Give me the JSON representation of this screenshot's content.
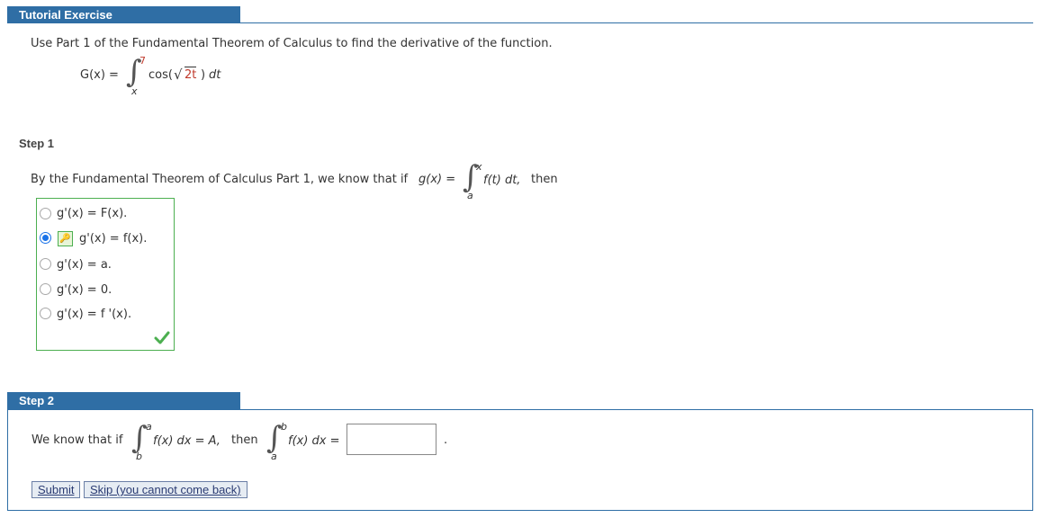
{
  "header": {
    "title": "Tutorial Exercise"
  },
  "problem": {
    "instruction": "Use Part 1 of the Fundamental Theorem of Calculus to find the derivative of the function.",
    "lhs": "G(x) =",
    "upper": "7",
    "lower": "x",
    "cos_open": "cos(",
    "radicand": "2t",
    "close": ")",
    "dt": "dt"
  },
  "step1": {
    "label": "Step 1",
    "text": "By the Fundamental Theorem of Calculus Part 1, we know that if",
    "g_def": "g(x) =",
    "upper": "x",
    "lower": "a",
    "integrand": "f(t) dt,",
    "then": "then",
    "choices": [
      {
        "label": "g'(x) = F(x).",
        "selected": false
      },
      {
        "label": "g'(x) = f(x).",
        "selected": true
      },
      {
        "label": "g'(x) = a.",
        "selected": false
      },
      {
        "label": "g'(x) = 0.",
        "selected": false
      },
      {
        "label": "g'(x) = f '(x).",
        "selected": false
      }
    ],
    "correct_icon": "checkmark-icon"
  },
  "step2": {
    "label": "Step 2",
    "text_if": "We know that if",
    "int1_upper": "a",
    "int1_lower": "b",
    "int1_body": "f(x) dx = A,",
    "then": "then",
    "int2_upper": "b",
    "int2_lower": "a",
    "int2_body": "f(x) dx =",
    "answer_value": "",
    "period": ".",
    "submit_label": "Submit",
    "skip_label": "Skip (you cannot come back)"
  },
  "colors": {
    "header": "#2f6ea5",
    "correct": "#4caf50",
    "radio_selected": "#1a73e8"
  }
}
